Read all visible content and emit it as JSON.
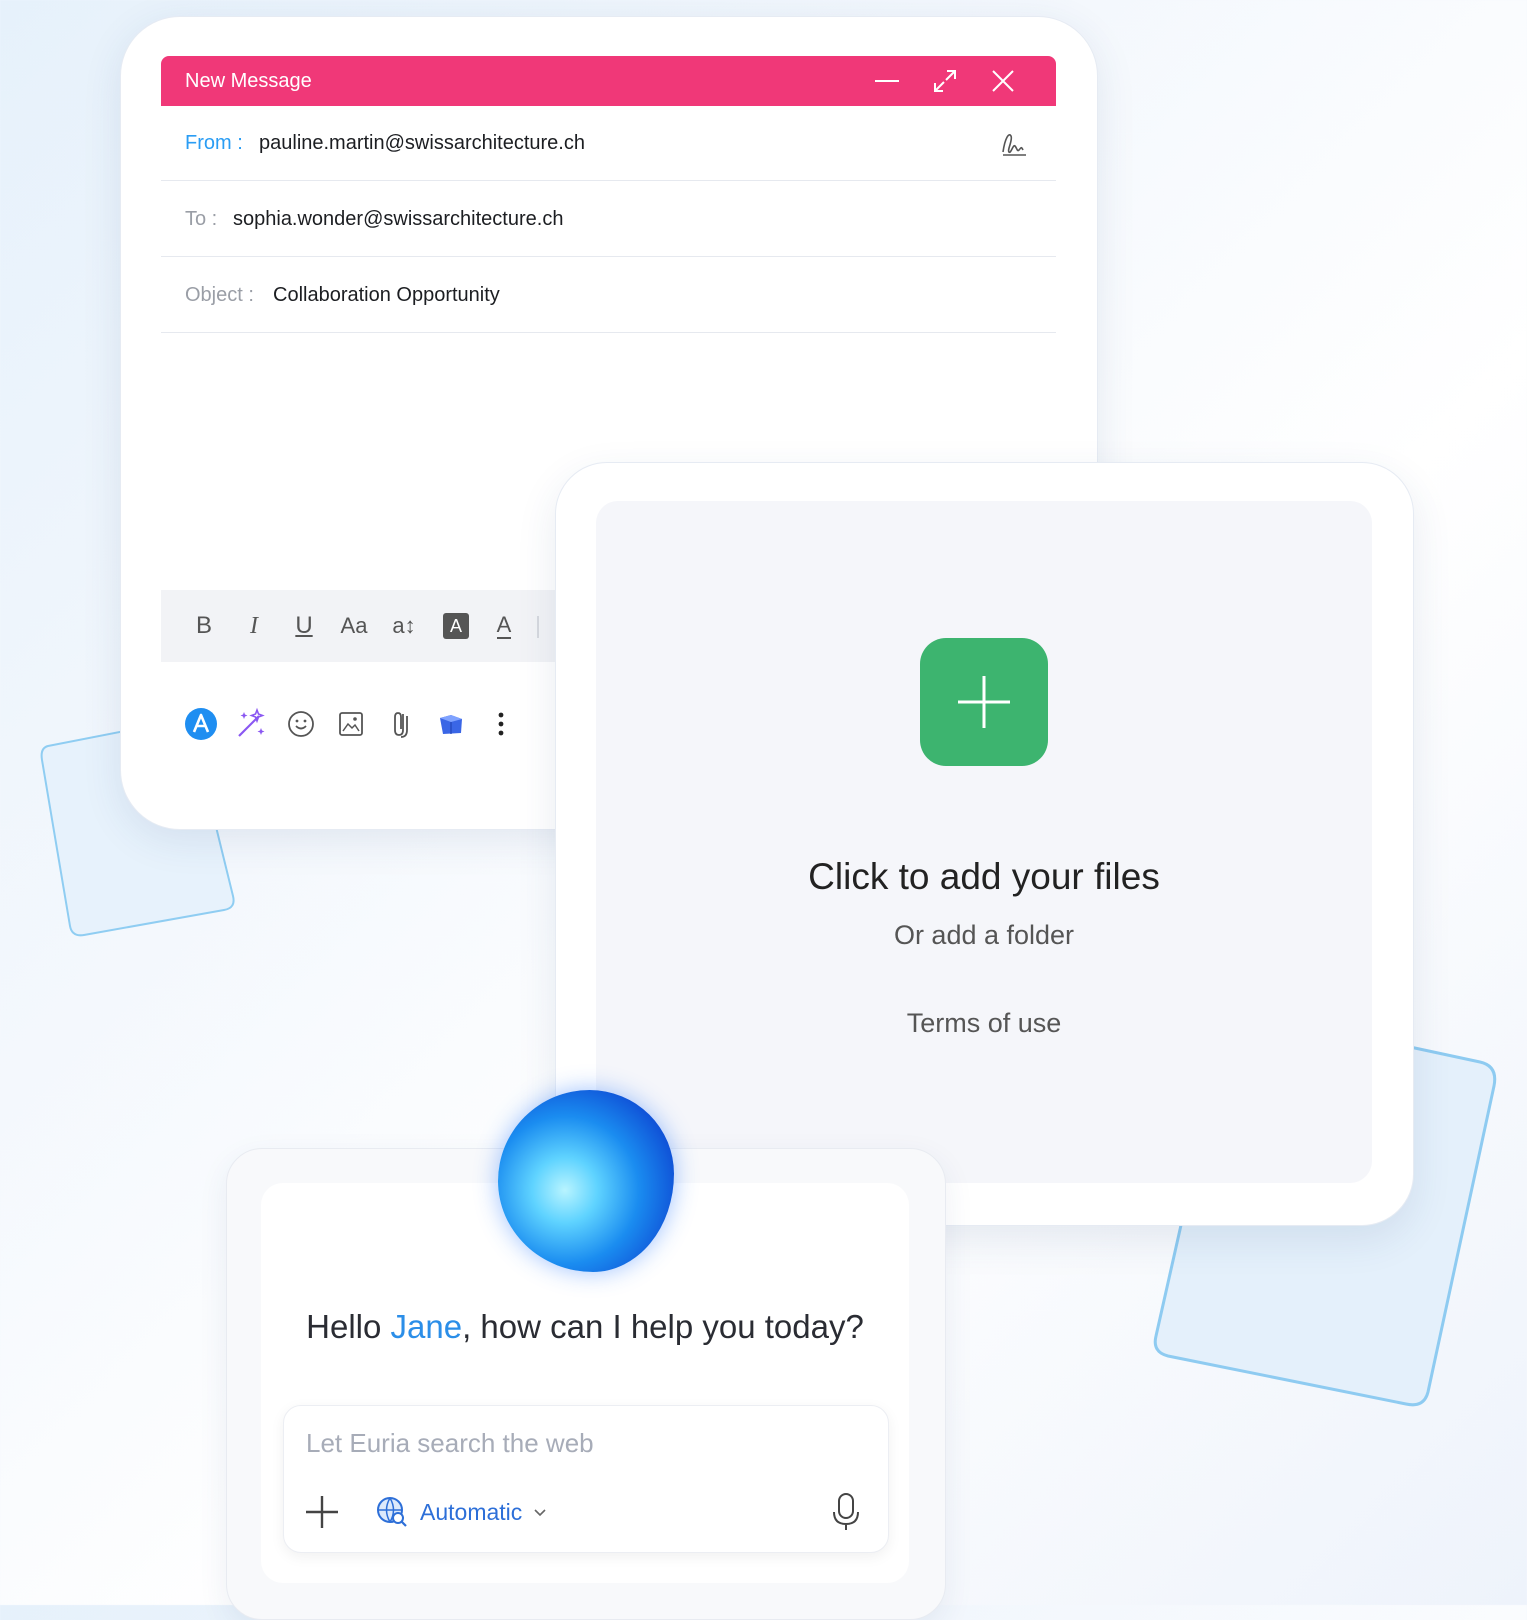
{
  "compose": {
    "title": "New Message",
    "from_label": "From :",
    "from_value": "pauline.martin@swissarchitecture.ch",
    "to_label": "To :",
    "to_value": "sophia.wonder@swissarchitecture.ch",
    "object_label": "Object :",
    "object_value": "Collaboration Opportunity",
    "format_tools": [
      "B",
      "I",
      "U",
      "Aa",
      "a↕",
      "A",
      "A"
    ],
    "colors": {
      "header": "#f03878",
      "from_label": "#2a9df4"
    }
  },
  "dropzone": {
    "title": "Click to add your files",
    "subtitle": "Or add a folder",
    "terms": "Terms of use",
    "colors": {
      "add_button": "#3db46f"
    }
  },
  "assistant": {
    "greeting_prefix": "Hello ",
    "user_name": "Jane",
    "greeting_suffix": ", how can I help you today?",
    "input_placeholder": "Let Euria search the web",
    "mode_label": "Automatic",
    "colors": {
      "name": "#2b8ee8",
      "mode": "#2d6fd8"
    }
  }
}
